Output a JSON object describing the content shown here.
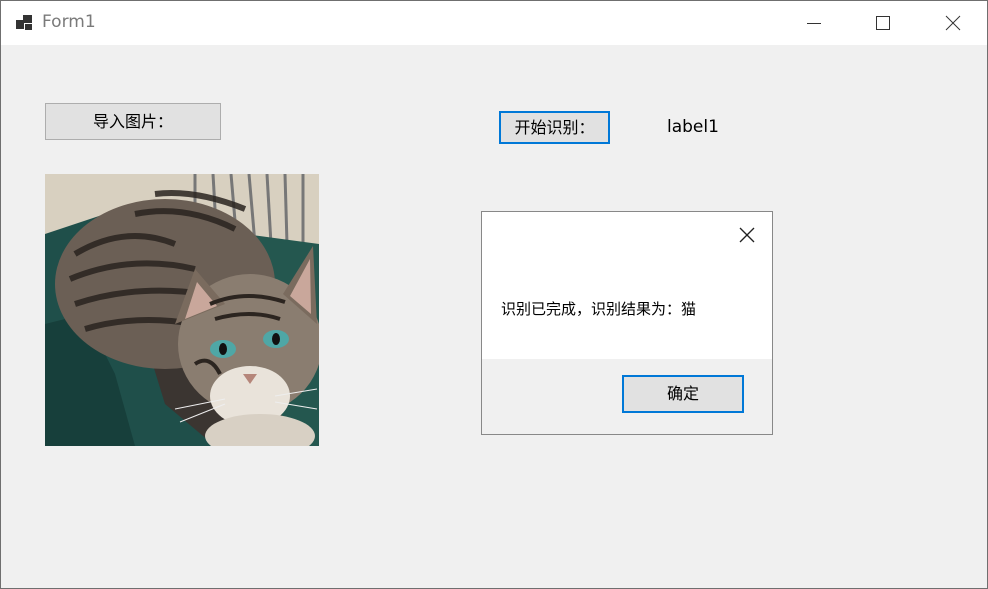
{
  "window": {
    "title": "Form1",
    "icons": {
      "app": "app-icon",
      "minimize": "minimize-icon",
      "maximize": "maximize-icon",
      "close": "close-icon"
    }
  },
  "main": {
    "import_button_label": "导入图片：",
    "start_button_label": "开始识别：",
    "result_label": "label1",
    "picture": {
      "subject": "cat-photo"
    }
  },
  "dialog": {
    "message": "识别已完成，识别结果为：猫",
    "ok_label": "确定",
    "close_icon": "close-icon"
  },
  "colors": {
    "accent": "#0078d7",
    "window_bg": "#f0f0f0",
    "button_bg": "#e1e1e1"
  }
}
